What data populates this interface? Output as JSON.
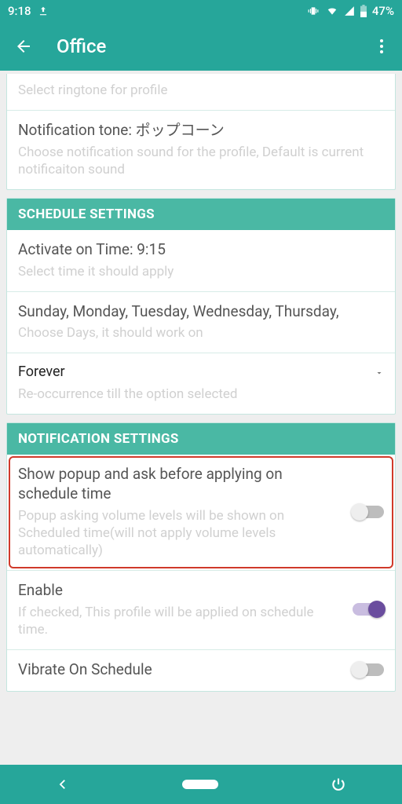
{
  "status": {
    "time": "9:18",
    "battery": "47%"
  },
  "header": {
    "title": "Office"
  },
  "ringtone_row": {
    "sub": "Select ringtone for profile"
  },
  "notif_tone_row": {
    "title": "Notification tone: ポップコーン",
    "sub": "Choose notification sound for the profile, Default is current notificaiton sound"
  },
  "sections": {
    "schedule_header": "SCHEDULE SETTINGS",
    "notification_header": "NOTIFICATION SETTINGS"
  },
  "schedule": {
    "activate": {
      "title": "Activate on Time: 9:15",
      "sub": "Select time it should apply"
    },
    "days": {
      "title": "Sunday, Monday, Tuesday, Wednesday, Thursday,",
      "sub": "Choose Days, it should work on"
    },
    "recur": {
      "title": "Forever",
      "sub": "Re-occurrence till the option selected"
    }
  },
  "notification": {
    "popup": {
      "title": "Show popup and ask before applying on schedule time",
      "sub": "Popup asking volume levels will be shown on Scheduled time(will not apply volume levels automatically)",
      "on": false
    },
    "enable": {
      "title": "Enable",
      "sub": "If checked, This profile will be applied on schedule time.",
      "on": true
    },
    "vibrate": {
      "title": "Vibrate On Schedule",
      "on": false
    }
  }
}
